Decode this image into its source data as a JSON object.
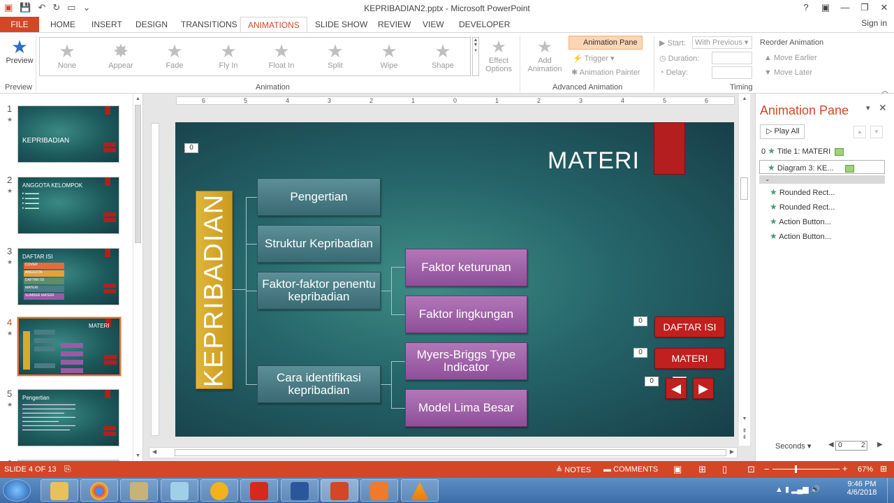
{
  "window": {
    "title": "KEPRIBADIAN2.pptx - Microsoft PowerPoint",
    "signin": "Sign in",
    "help": "?"
  },
  "tabs": [
    "FILE",
    "HOME",
    "INSERT",
    "DESIGN",
    "TRANSITIONS",
    "ANIMATIONS",
    "SLIDE SHOW",
    "REVIEW",
    "VIEW",
    "DEVELOPER"
  ],
  "ribbon": {
    "preview_label": "Preview",
    "preview_group": "Preview",
    "animations": [
      "None",
      "Appear",
      "Fade",
      "Fly In",
      "Float In",
      "Split",
      "Wipe",
      "Shape"
    ],
    "effect_options": [
      "Effect",
      "Options"
    ],
    "animation_group": "Animation",
    "add_animation": [
      "Add",
      "Animation"
    ],
    "animation_pane": "Animation Pane",
    "trigger": "Trigger",
    "animation_painter": "Animation Painter",
    "advanced_group": "Advanced Animation",
    "start_label": "Start:",
    "start_value": "With Previous",
    "duration_label": "Duration:",
    "delay_label": "Delay:",
    "reorder": "Reorder Animation",
    "move_earlier": "Move Earlier",
    "move_later": "Move Later",
    "timing_group": "Timing"
  },
  "ruler_ticks": [
    "6",
    "5",
    "4",
    "3",
    "2",
    "1",
    "0",
    "1",
    "2",
    "3",
    "4",
    "5",
    "6"
  ],
  "slides": [
    {
      "num": "1",
      "title": "KEPRIBADIAN"
    },
    {
      "num": "2",
      "title": "ANGGOTA KELOMPOK"
    },
    {
      "num": "3",
      "title": "DAFTAR ISI"
    },
    {
      "num": "4",
      "title": "MATERI"
    },
    {
      "num": "5",
      "title": "Pengertian"
    },
    {
      "num": "6",
      "title": ""
    }
  ],
  "slide3_items": [
    "COVER",
    "ANGGOTA",
    "DAFTAR ISI",
    "MATERI",
    "SUMBER MATERI"
  ],
  "slide": {
    "title": "MATERI",
    "vertical": "KEPRIBADIAN",
    "col1": [
      "Pengertian",
      "Struktur Kepribadian",
      "Faktor-faktor penentu kepribadian",
      "Cara identifikasi kepribadian"
    ],
    "col2": [
      "Faktor keturunan",
      "Faktor lingkungan",
      "Myers-Briggs Type Indicator",
      "Model Lima Besar"
    ],
    "btn_daftar": "DAFTAR ISI",
    "btn_materi": "MATERI",
    "tag": "0"
  },
  "pane": {
    "title": "Animation Pane",
    "play_all": "Play All",
    "items": [
      {
        "n": "0",
        "label": "Title 1: MATERI",
        "bar": true
      },
      {
        "n": "",
        "label": "Diagram 3: KE...",
        "bar": true
      },
      {
        "n": "",
        "label": "Rounded Rect...",
        "bar": false
      },
      {
        "n": "",
        "label": "Rounded Rect...",
        "bar": false
      },
      {
        "n": "",
        "label": "Action Button...",
        "bar": false
      },
      {
        "n": "",
        "label": "Action Button...",
        "bar": false
      }
    ],
    "seconds": "Seconds",
    "t0": "0",
    "t2": "2"
  },
  "status": {
    "slide": "SLIDE 4 OF 13",
    "notes": "NOTES",
    "comments": "COMMENTS",
    "zoom": "67%"
  },
  "clock": {
    "time": "9:46 PM",
    "date": "4/6/2018"
  },
  "colors": {
    "accent": "#d24726",
    "slide_bg": "#25656a",
    "teal_box": "#4a7c85",
    "purple_box": "#9c5aa6",
    "gold": "#d9a92a",
    "red": "#c0201e"
  }
}
